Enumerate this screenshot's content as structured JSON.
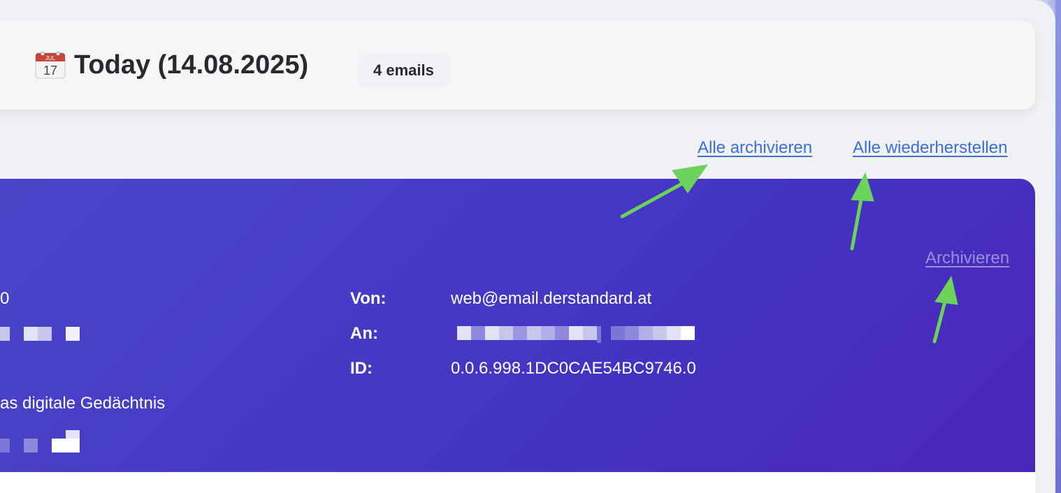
{
  "header": {
    "calendar_icon": "calendar-icon",
    "calendar_month": "JUL",
    "calendar_day": "17",
    "title": "Today (14.08.2025)",
    "email_count": "4 emails"
  },
  "actions": {
    "archive_all": "Alle archivieren",
    "restore_all": "Alle wiederherstellen"
  },
  "email": {
    "archive_label": "Archivieren",
    "from_label": "Von:",
    "from_value": "web@email.derstandard.at",
    "to_label": "An:",
    "id_label": "ID:",
    "id_value": "0.0.6.998.1DC0CAE54BC9746.0",
    "left_top_fragment": "0",
    "subject_fragment": "as digitale Gedächtnis"
  },
  "colors": {
    "card_gradient_start": "#4a47c9",
    "card_gradient_end": "#4b25b8",
    "link": "#3b6fd6",
    "annotation_arrow": "#6bd35a"
  }
}
